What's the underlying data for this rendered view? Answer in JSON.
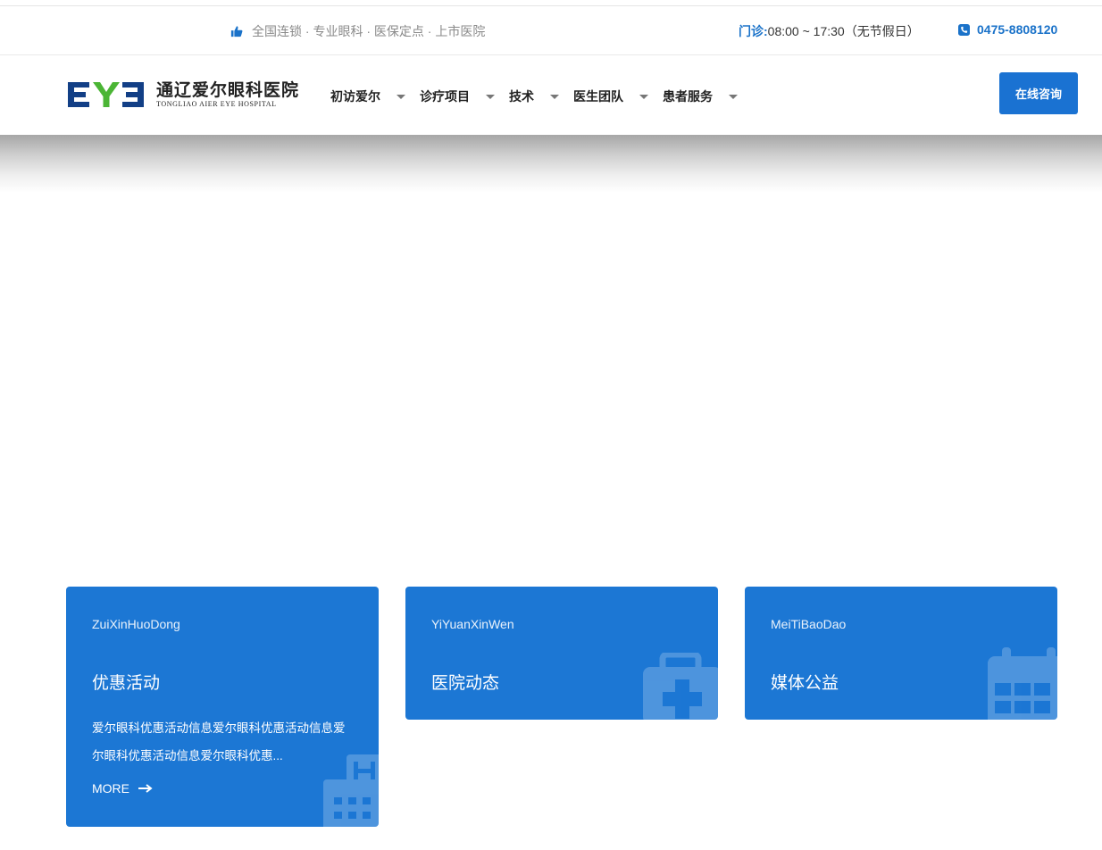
{
  "topbar": {
    "tagline": "全国连锁 · 专业眼科 · 医保定点 · 上市医院",
    "hours_label": "门诊:",
    "hours_value": "08:00 ~ 17:30（无节假日）",
    "phone": "0475-8808120"
  },
  "logo": {
    "mark": "EYE",
    "name_cn": "通辽爱尔眼科医院",
    "name_en": "TONGLIAO AIER EYE HOSPITAL",
    "colors": {
      "blue": "#123f86",
      "green": "#4bb535"
    }
  },
  "nav": {
    "items": [
      {
        "label": "初访爱尔"
      },
      {
        "label": "诊疗项目"
      },
      {
        "label": "技术"
      },
      {
        "label": "医生团队"
      },
      {
        "label": "患者服务"
      }
    ],
    "consult_label": "在线咨询"
  },
  "cards": [
    {
      "en": "ZuiXinHuoDong",
      "title": "优惠活动",
      "desc": "爱尔眼科优惠活动信息爱尔眼科优惠活动信息爱尔眼科优惠活动信息爱尔眼科优惠...",
      "more": "MORE",
      "icon": "hospital-building-icon"
    },
    {
      "en": "YiYuanXinWen",
      "title": "医院动态",
      "icon": "medical-kit-icon"
    },
    {
      "en": "MeiTiBaoDao",
      "title": "媒体公益",
      "icon": "calendar-icon"
    }
  ],
  "colors": {
    "accent": "#1a72d2",
    "card": "#1c77d4"
  }
}
